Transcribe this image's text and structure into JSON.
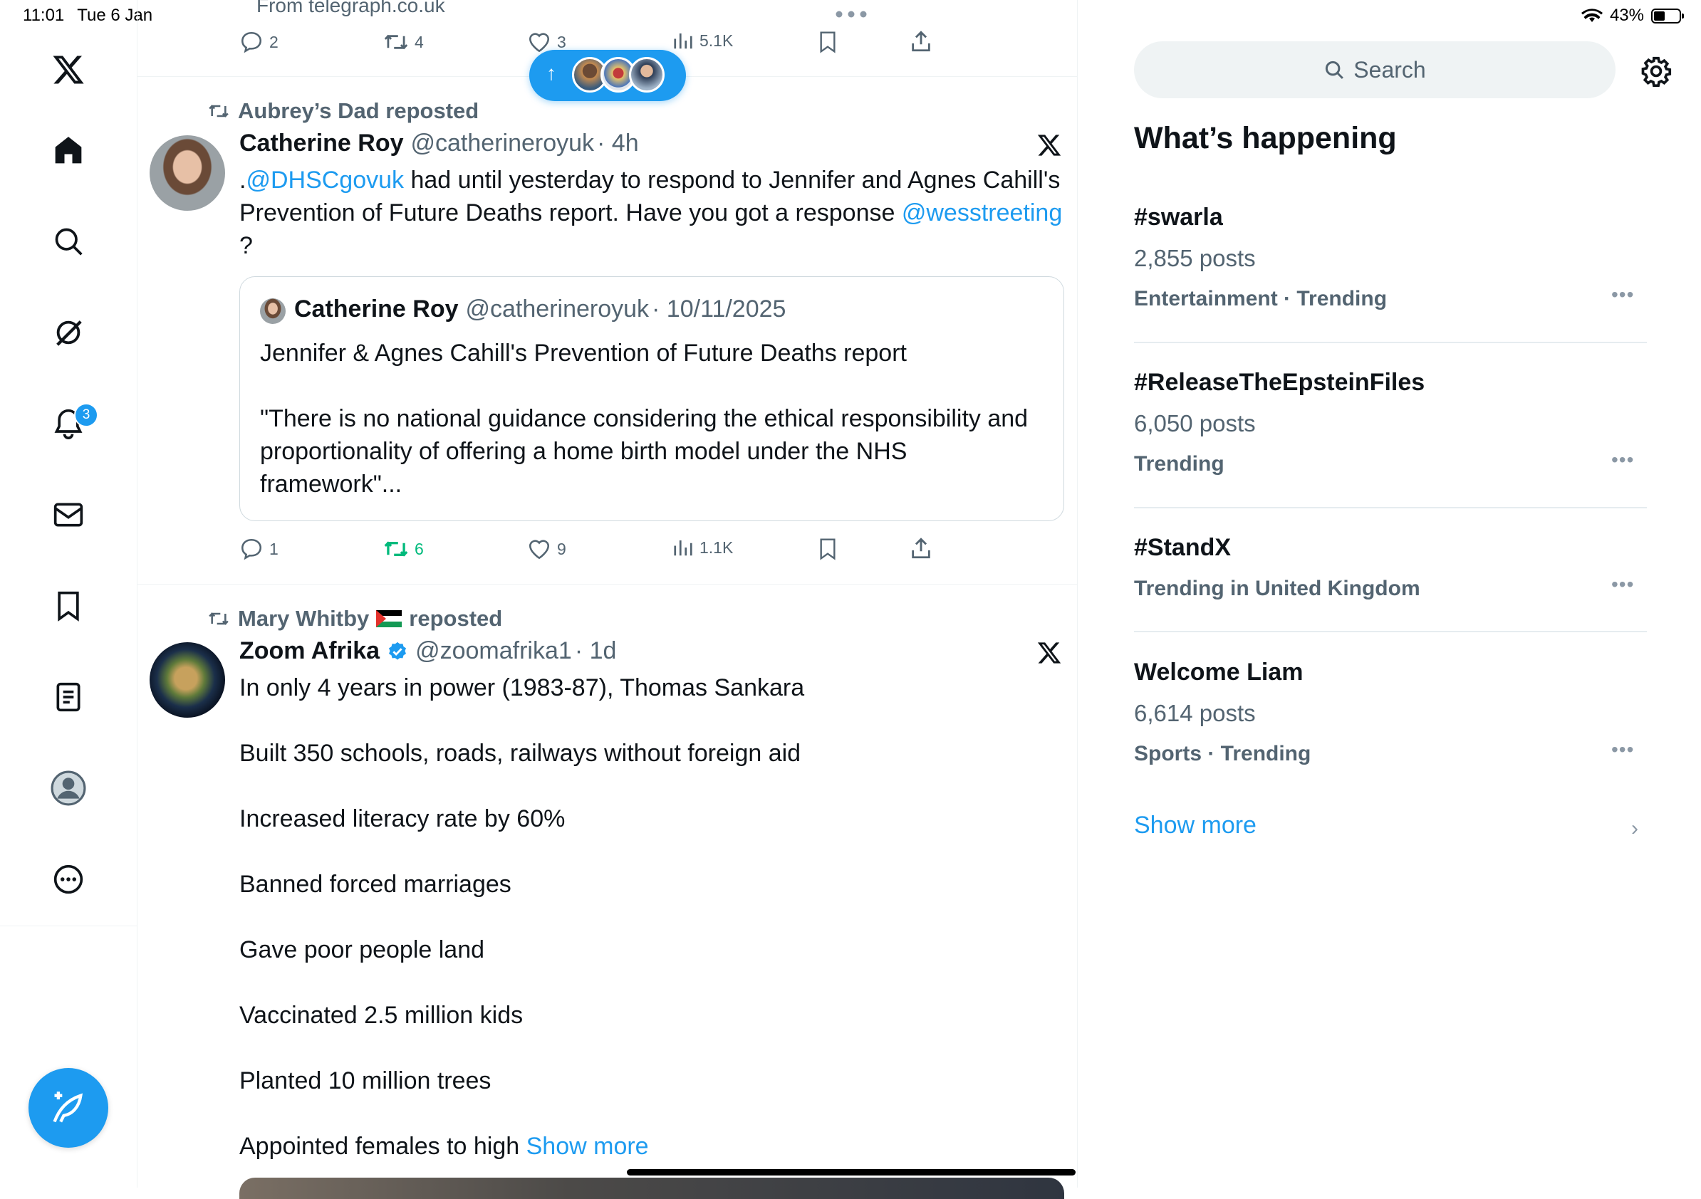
{
  "status_bar": {
    "time": "11:01",
    "date": "Tue 6 Jan",
    "battery": "43%",
    "battery_level": 0.43
  },
  "nav": {
    "items": [
      "home",
      "explore",
      "grok",
      "notifications",
      "messages",
      "bookmarks",
      "lists",
      "profile",
      "more"
    ],
    "notifications_badge": "3",
    "compose_label": "Post"
  },
  "timeline": {
    "top_tweet": {
      "source": "From telegraph.co.uk",
      "replies": "2",
      "reposts": "4",
      "likes": "3",
      "views": "5.1K"
    },
    "new_posts_pill": {
      "arrow": "↑"
    },
    "tweet1": {
      "reposted_by": "Aubrey’s Dad reposted",
      "name": "Catherine Roy",
      "handle": "@catherineroyuk",
      "time": "· 4h",
      "text_pre": ".",
      "mention1": "@DHSCgovuk",
      "text_mid": " had until yesterday to respond to Jennifer and Agnes Cahill's Prevention of Future Deaths report. Have you got a response ",
      "mention2": "@wesstreeting",
      "text_end": " ?",
      "quote": {
        "name": "Catherine Roy",
        "handle": "@catherineroyuk",
        "date": "· 10/11/2025",
        "line1": "Jennifer & Agnes Cahill's Prevention of Future Deaths report",
        "line2": "\"There is no national guidance considering the ethical responsibility and proportionality of offering a home birth model under the NHS framework\"..."
      },
      "replies": "1",
      "reposts": "6",
      "likes": "9",
      "views": "1.1K"
    },
    "tweet2": {
      "reposted_by_name": "Mary Whitby",
      "reposted_suffix": "reposted",
      "name": "Zoom Afrika",
      "handle": "@zoomafrika1",
      "time": "· 1d",
      "lines": [
        "In only  4 years in power (1983-87), Thomas Sankara",
        "Built 350 schools, roads, railways without foreign aid",
        "Increased literacy rate by 60%",
        "Banned forced marriages",
        "Gave poor people land",
        "Vaccinated 2.5 million kids",
        "Planted 10 million trees",
        "Appointed females to high"
      ],
      "show_more": "Show more"
    }
  },
  "sidebar": {
    "search_placeholder": "Search",
    "heading": "What’s happening",
    "trends": [
      {
        "tag": "#swarla",
        "count": "2,855 posts",
        "category": "Entertainment · Trending"
      },
      {
        "tag": "#ReleaseTheEpsteinFiles",
        "count": "6,050 posts",
        "category": "Trending"
      },
      {
        "tag": "#StandX",
        "count": "",
        "category": "Trending in United Kingdom"
      },
      {
        "tag": "Welcome Liam",
        "count": "6,614 posts",
        "category": "Sports · Trending"
      }
    ],
    "show_more": "Show more"
  },
  "colors": {
    "accent": "#1d9bf0",
    "repost_green": "#00ba7c",
    "secondary_text": "#536471"
  }
}
